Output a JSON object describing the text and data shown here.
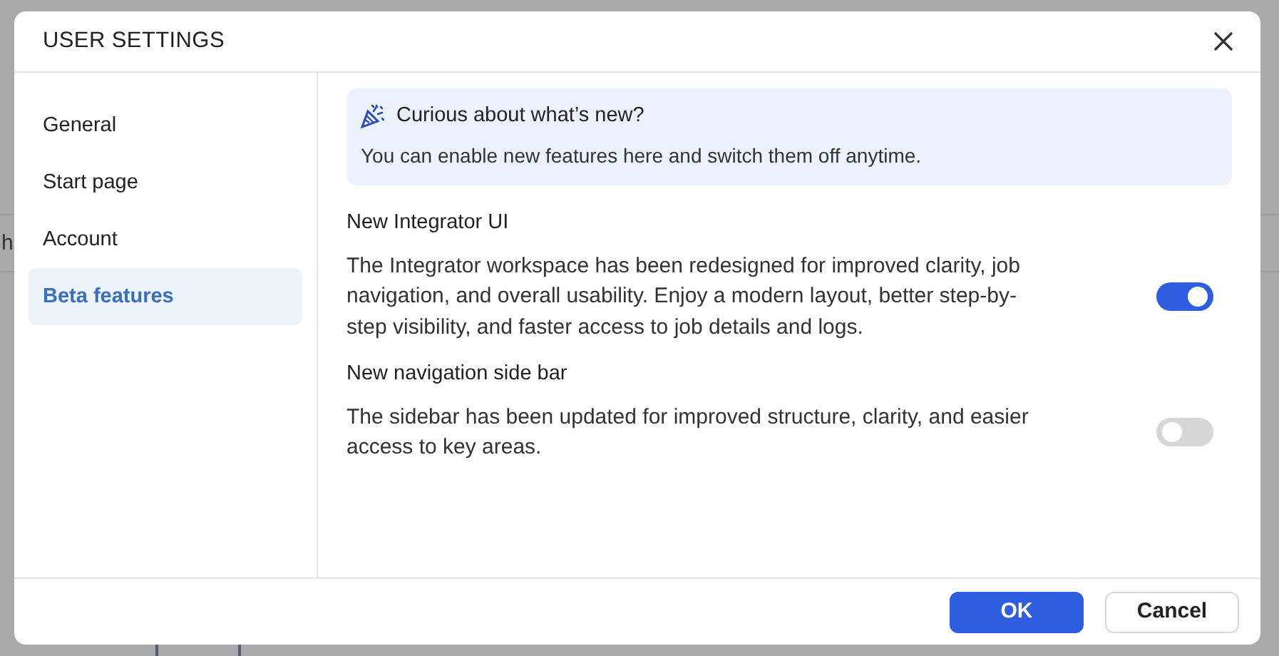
{
  "backdrop": {
    "text_fragment": "h"
  },
  "dialog": {
    "title": "USER SETTINGS",
    "sidebar": {
      "items": [
        {
          "label": "General",
          "selected": false
        },
        {
          "label": "Start page",
          "selected": false
        },
        {
          "label": "Account",
          "selected": false
        },
        {
          "label": "Beta features",
          "selected": true
        }
      ]
    },
    "notice": {
      "title": "Curious about what’s new?",
      "text": "You can enable new features here and switch them off anytime."
    },
    "features": [
      {
        "title": "New Integrator UI",
        "description": "The Integrator workspace has been redesigned for improved clarity, job navigation, and overall usability. Enjoy a modern layout, better step-by-step visibility, and faster access to job details and logs.",
        "on": true
      },
      {
        "title": "New navigation side bar",
        "description": "The sidebar has been updated for improved structure, clarity, and easier access to key areas.",
        "on": false
      }
    ],
    "buttons": [
      {
        "label": "OK",
        "kind": "primary"
      },
      {
        "label": "Cancel",
        "kind": "secondary"
      }
    ]
  }
}
